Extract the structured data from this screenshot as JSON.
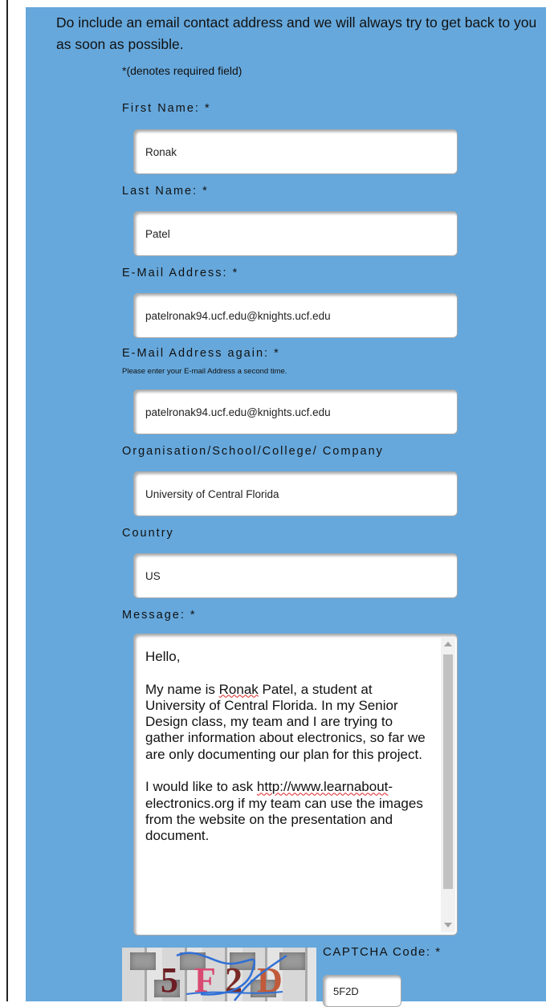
{
  "intro": "Do include an email contact address and we will always try to get back to you as soon as possible.",
  "required_note": "*(denotes required field)",
  "fields": {
    "first_name": {
      "label": "First Name: *",
      "value": "Ronak"
    },
    "last_name": {
      "label": "Last Name: *",
      "value": "Patel"
    },
    "email": {
      "label": "E-Mail Address: *",
      "value": "patelronak94.ucf.edu@knights.ucf.edu"
    },
    "email_again": {
      "label": "E-Mail Address again: *",
      "hint": "Please enter your E-mail Address a second time.",
      "value": "patelronak94.ucf.edu@knights.ucf.edu"
    },
    "organisation": {
      "label": "Organisation/School/College/ Company",
      "value": "University of Central Florida"
    },
    "country": {
      "label": "Country",
      "value": "US"
    },
    "message": {
      "label": "Message: *",
      "greeting": "Hello,",
      "p1_before": "My name is ",
      "p1_name": "Ronak",
      "p1_after": " Patel, a student at University of Central Florida. In my Senior Design class, my team and I are trying to gather information about electronics, so far we are only documenting our plan for this project.",
      "p2_before": "I would like to ask ",
      "p2_link_a": "http://www.learnabout",
      "p2_link_b": "-electronics.org",
      "p2_after": " if my team can use the images from the website on the presentation and document."
    }
  },
  "captcha": {
    "image_text": [
      "5",
      "F",
      "2",
      "D"
    ],
    "label": "CAPTCHA Code: *",
    "value": "5F2D"
  },
  "colors": {
    "panel": "#66a8dc",
    "captcha_chars": [
      "#6b1d23",
      "#d94a72",
      "#7a2b26",
      "#c05a3a"
    ]
  }
}
